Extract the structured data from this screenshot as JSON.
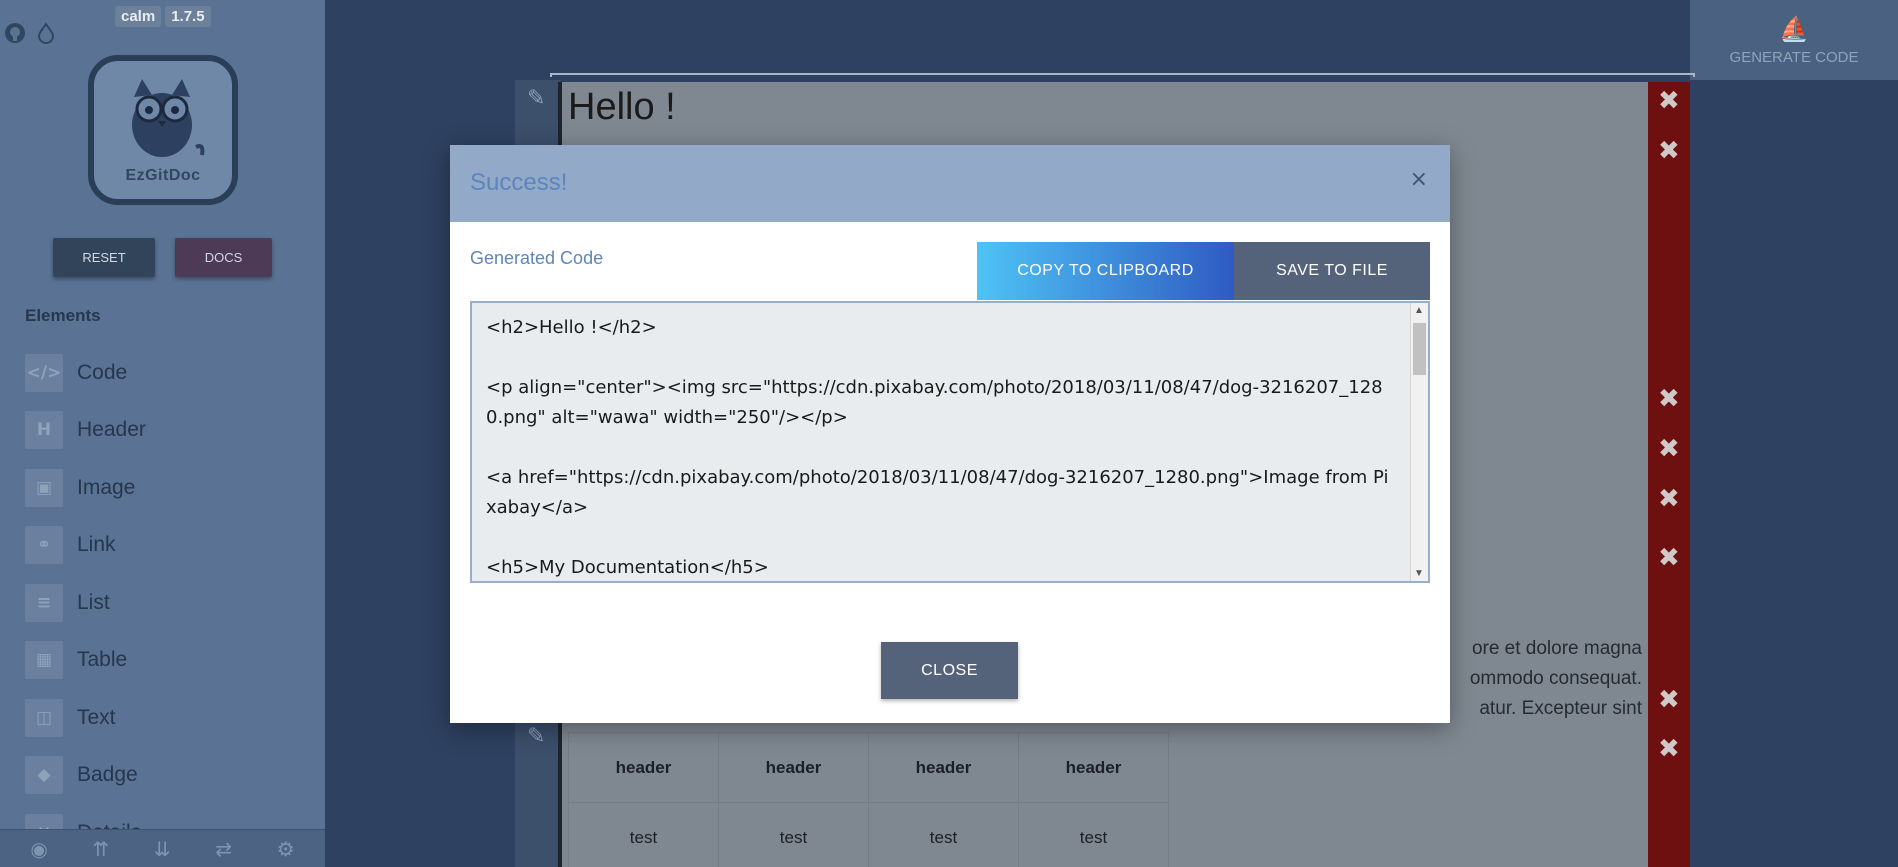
{
  "sidebar": {
    "version_theme": "calm",
    "version_number": "1.7.5",
    "logo_text": "EzGitDoc",
    "reset_label": "RESET",
    "docs_label": "DOCS",
    "elements_title": "Elements",
    "items": [
      {
        "label": "Code",
        "icon": "code-icon",
        "glyph": "</>"
      },
      {
        "label": "Header",
        "icon": "header-icon",
        "glyph": "H"
      },
      {
        "label": "Image",
        "icon": "image-icon",
        "glyph": "▣"
      },
      {
        "label": "Link",
        "icon": "link-icon",
        "glyph": "⚭"
      },
      {
        "label": "List",
        "icon": "list-icon",
        "glyph": "≡"
      },
      {
        "label": "Table",
        "icon": "table-icon",
        "glyph": "▦"
      },
      {
        "label": "Text",
        "icon": "text-icon",
        "glyph": "◫"
      },
      {
        "label": "Badge",
        "icon": "badge-icon",
        "glyph": "◆"
      },
      {
        "label": "Details",
        "icon": "details-icon",
        "glyph": "✕"
      }
    ],
    "bottom_icons": [
      "eye-icon",
      "double-chevron-up-icon",
      "double-chevron-down-icon",
      "swap-icon",
      "gear-icon"
    ]
  },
  "toolbar": {
    "generate_label": "GENERATE CODE"
  },
  "canvas": {
    "heading": "Hello !",
    "paragraph_lines": [
      "ore et dolore magna",
      "ommodo consequat.",
      "atur. Excepteur sint"
    ],
    "table": {
      "headers": [
        "header",
        "header",
        "header",
        "header"
      ],
      "rows": [
        [
          "test",
          "test",
          "test",
          "test"
        ]
      ]
    }
  },
  "modal": {
    "title": "Success!",
    "close_x": "×",
    "generated_label": "Generated Code",
    "copy_label": "COPY TO CLIPBOARD",
    "save_label": "SAVE TO FILE",
    "code": "<h2>Hello !</h2>\n\n<p align=\"center\"><img src=\"https://cdn.pixabay.com/photo/2018/03/11/08/47/dog-3216207_1280.png\" alt=\"wawa\" width=\"250\"/></p>\n\n<a href=\"https://cdn.pixabay.com/photo/2018/03/11/08/47/dog-3216207_1280.png\">Image from Pixabay</a>\n\n<h5>My Documentation</h5>",
    "close_label": "CLOSE"
  },
  "colors": {
    "sidebar_bg": "#5a7394",
    "modal_header": "#93a9c8",
    "copy_gradient_start": "#4ec3f5",
    "copy_gradient_end": "#2f5bc3",
    "save_btn": "#55637a",
    "delete_col": "#6f1010"
  }
}
